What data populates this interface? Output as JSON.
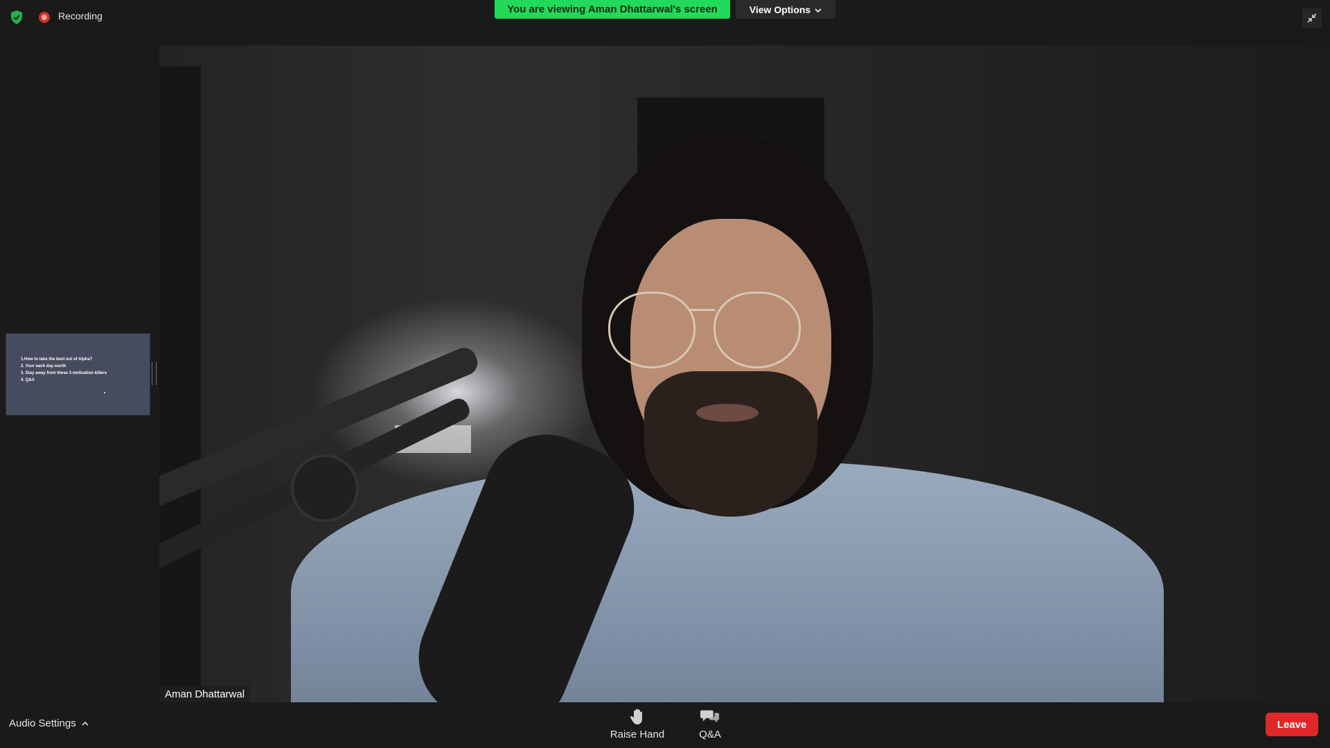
{
  "topbar": {
    "security_icon": "shield-check-icon",
    "recording_icon": "record-dot-icon",
    "recording_label": "Recording",
    "share_banner": "You are viewing Aman Dhattarwal's screen",
    "view_options_label": "View Options",
    "exit_fullscreen_icon": "exit-fullscreen-icon"
  },
  "thumbnail": {
    "lines": [
      "1.How to take the best out of Alpha?",
      "2. Your each day worth",
      "3. Stay away from these 3 motivation killers",
      "4. Q&A"
    ]
  },
  "video": {
    "speaker_name": "Aman Dhattarwal"
  },
  "toolbar": {
    "audio_settings_label": "Audio Settings",
    "raise_hand_label": "Raise Hand",
    "qa_label": "Q&A",
    "leave_label": "Leave"
  },
  "colors": {
    "share_banner_green": "#23d959",
    "leave_red": "#e02828",
    "background": "#1a1a1a"
  }
}
